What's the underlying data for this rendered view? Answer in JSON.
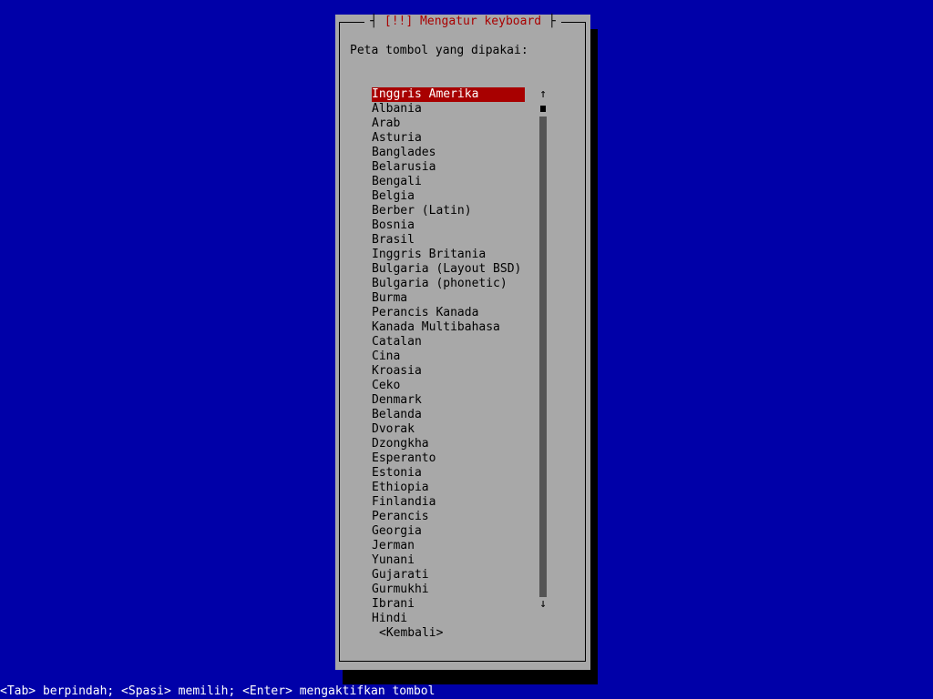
{
  "colors": {
    "background": "#0000a8",
    "dialog": "#a8a8a8",
    "shadow": "#000000",
    "title": "#a80000",
    "selection_bg": "#a80000",
    "selection_fg": "#ffffff",
    "statusbar_text": "#ffffff"
  },
  "dialog": {
    "title_cap_left": "┤",
    "title": "[!!] Mengatur keyboard",
    "title_cap_right": "├",
    "prompt": "Peta tombol yang dipakai:"
  },
  "keymaps": {
    "selected_index": 0,
    "items": [
      "Inggris Amerika",
      "Albania",
      "Arab",
      "Asturia",
      "Banglades",
      "Belarusia",
      "Bengali",
      "Belgia",
      "Berber (Latin)",
      "Bosnia",
      "Brasil",
      "Inggris Britania",
      "Bulgaria (Layout BSD)",
      "Bulgaria (phonetic)",
      "Burma",
      "Perancis Kanada",
      "Kanada Multibahasa",
      "Catalan",
      "Cina",
      "Kroasia",
      "Ceko",
      "Denmark",
      "Belanda",
      "Dvorak",
      "Dzongkha",
      "Esperanto",
      "Estonia",
      "Ethiopia",
      "Finlandia",
      "Perancis",
      "Georgia",
      "Jerman",
      "Yunani",
      "Gujarati",
      "Gurmukhi",
      "Ibrani",
      "Hindi"
    ]
  },
  "scrollbar": {
    "up_arrow": "↑",
    "down_arrow": "↓"
  },
  "buttons": {
    "back": "<Kembali>"
  },
  "statusbar": {
    "text": "<Tab> berpindah; <Spasi> memilih; <Enter> mengaktifkan tombol"
  }
}
